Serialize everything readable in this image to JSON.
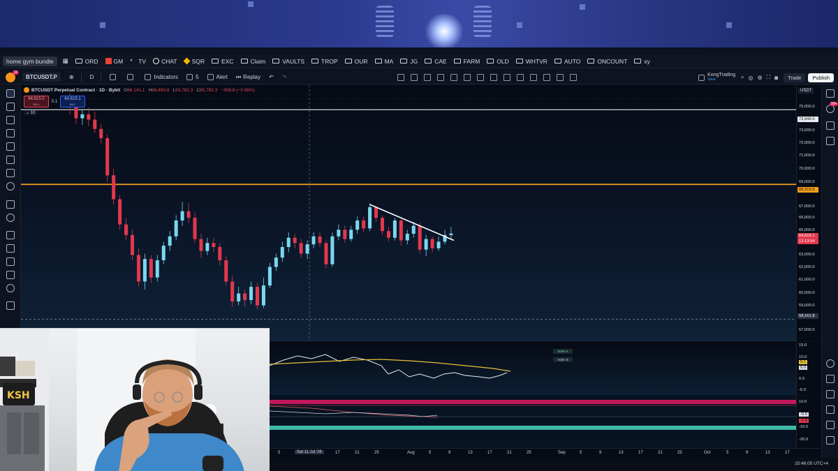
{
  "bookmarks": [
    {
      "label": "ORD",
      "icon": "folder-icon"
    },
    {
      "label": "GM",
      "icon": "gmail-icon"
    },
    {
      "label": "TV",
      "icon": "tradingview-icon"
    },
    {
      "label": "CHAT",
      "icon": "chatgpt-icon"
    },
    {
      "label": "SQR",
      "icon": "binance-icon"
    },
    {
      "label": "EXC",
      "icon": "folder-icon"
    },
    {
      "label": "Claim",
      "icon": "folder-icon"
    },
    {
      "label": "VAULTS",
      "icon": "folder-icon"
    },
    {
      "label": "TROP",
      "icon": "folder-icon"
    },
    {
      "label": "OUR",
      "icon": "folder-icon"
    },
    {
      "label": "MA",
      "icon": "folder-icon"
    },
    {
      "label": "JG",
      "icon": "folder-icon"
    },
    {
      "label": "CAE",
      "icon": "folder-icon"
    },
    {
      "label": "FARM",
      "icon": "folder-icon"
    },
    {
      "label": "OLD",
      "icon": "folder-icon"
    },
    {
      "label": "WHTVR",
      "icon": "folder-icon"
    },
    {
      "label": "AUTO",
      "icon": "folder-icon"
    },
    {
      "label": "ONCOUNT",
      "icon": "folder-icon"
    },
    {
      "label": "xy",
      "icon": "folder-icon"
    }
  ],
  "bookmark_first": "home gym bundle",
  "toolbar": {
    "notif_badge": "11",
    "symbol": "BTCUSDT.P",
    "interval": "D",
    "indicators": "Indicators",
    "layouts_count": "5",
    "alert": "Alert",
    "replay": "Replay",
    "user": "KongTrading",
    "user_sub": "Save",
    "trade": "Trade",
    "publish": "Publish"
  },
  "legend": {
    "title": "BTCUSDT Perpetual Contract · 1D · Bybit",
    "ohlc": [
      {
        "k": "O",
        "v": "66,141.1"
      },
      {
        "k": "H",
        "v": "66,490.8"
      },
      {
        "k": "L",
        "v": "63,782.3"
      },
      {
        "k": "C",
        "v": "65,782.3"
      }
    ],
    "change": "−358.8 (−0.56%)"
  },
  "order": {
    "sell_price": "64,615.0",
    "sell_label": "SELL",
    "qty": "0.1",
    "buy_price": "64,615.1",
    "buy_label": "BUY",
    "collapse": "10"
  },
  "price_scale": {
    "currency": "USDT",
    "labels": [
      "75,000.0",
      "73,000.0",
      "72,000.0",
      "71,000.0",
      "70,000.0",
      "69,000.0",
      "67,000.0",
      "66,000.0",
      "65,000.0",
      "63,000.0",
      "62,000.0",
      "61,000.0",
      "60,000.0",
      "59,000.0",
      "57,000.0"
    ],
    "tag_white": "73,949.0",
    "tag_orange": "68,319.9",
    "tag_last": "64,615.1",
    "tag_timer": "12:13:54",
    "tag_cursor": "58,161.8"
  },
  "pane1_scale": [
    "15.0",
    "10.0",
    "5.1",
    "5.0",
    "0.0",
    "-5.0"
  ],
  "pane2_scale": [
    "10.0",
    "-0.5",
    "-1.8",
    "-10.0",
    "-20.0"
  ],
  "index_labels": [
    "Index A",
    "Index B"
  ],
  "time_axis": [
    "5",
    "Sat 11 Jul '26",
    "17",
    "21",
    "25",
    "Aug",
    "5",
    "9",
    "13",
    "17",
    "21",
    "25",
    "Sep",
    "5",
    "9",
    "13",
    "17",
    "21",
    "25",
    "Oct",
    "5",
    "9",
    "13",
    "17"
  ],
  "clock": "15:46:05 UTC+4",
  "colors": {
    "up": "#7ad7f0",
    "down": "#e2384d",
    "orange_level": "#f59e1b",
    "white_level": "#e8ecf2"
  },
  "chart_data": {
    "type": "candlestick",
    "symbol": "BTCUSDT.P",
    "interval": "1D",
    "ylim": [
      56500,
      75800
    ],
    "levels": [
      73949.0,
      68319.9,
      58161.8
    ],
    "trendline": [
      [
        0,
        66800
      ],
      [
        1,
        64100
      ]
    ],
    "candles": [
      [
        74800,
        74700,
        75200,
        73600
      ],
      [
        74700,
        73300,
        74900,
        72900
      ],
      [
        73300,
        73600,
        74000,
        72800
      ],
      [
        73600,
        73200,
        74100,
        72700
      ],
      [
        73200,
        72500,
        73800,
        72200
      ],
      [
        72500,
        71800,
        72900,
        71400
      ],
      [
        71800,
        69000,
        72100,
        68500
      ],
      [
        69000,
        67200,
        69500,
        66800
      ],
      [
        67200,
        65300,
        67500,
        64900
      ],
      [
        65300,
        64500,
        65800,
        64100
      ],
      [
        64500,
        63000,
        64900,
        62600
      ],
      [
        63000,
        61000,
        63500,
        60600
      ],
      [
        61000,
        62700,
        63100,
        60400
      ],
      [
        62700,
        61300,
        63000,
        60900
      ],
      [
        61300,
        62600,
        63000,
        61000
      ],
      [
        62600,
        63700,
        64000,
        62300
      ],
      [
        63700,
        64400,
        64800,
        63300
      ],
      [
        64400,
        65600,
        66000,
        64100
      ],
      [
        65600,
        66300,
        67000,
        65200
      ],
      [
        66300,
        65800,
        66900,
        65400
      ],
      [
        65800,
        64200,
        66200,
        63900
      ],
      [
        64200,
        63300,
        64600,
        62800
      ],
      [
        63300,
        63900,
        64300,
        63000
      ],
      [
        63900,
        63600,
        64300,
        63200
      ],
      [
        63600,
        62600,
        63900,
        62200
      ],
      [
        62600,
        61000,
        62900,
        60700
      ],
      [
        61000,
        59500,
        61400,
        59100
      ],
      [
        59500,
        60100,
        60600,
        59200
      ],
      [
        60100,
        59600,
        60400,
        59100
      ],
      [
        59600,
        60600,
        61000,
        59300
      ],
      [
        60600,
        59200,
        60900,
        58900
      ],
      [
        59200,
        60700,
        61300,
        59000
      ],
      [
        60700,
        62100,
        62400,
        60500
      ],
      [
        62100,
        62800,
        63100,
        61800
      ],
      [
        62800,
        63600,
        64000,
        62500
      ],
      [
        63600,
        64300,
        64700,
        63200
      ],
      [
        64300,
        63900,
        64600,
        63500
      ],
      [
        63900,
        63100,
        64200,
        62800
      ],
      [
        63100,
        63800,
        64100,
        62700
      ],
      [
        63800,
        64400,
        64700,
        63500
      ],
      [
        64400,
        63900,
        64700,
        63600
      ],
      [
        63900,
        62300,
        64100,
        62000
      ],
      [
        62300,
        64400,
        64700,
        62100
      ],
      [
        64400,
        64900,
        65300,
        64100
      ],
      [
        64900,
        64200,
        65200,
        63900
      ],
      [
        64200,
        64900,
        65200,
        64000
      ],
      [
        64900,
        65600,
        65900,
        64600
      ],
      [
        65600,
        65000,
        65900,
        64700
      ],
      [
        65000,
        66600,
        66900,
        64800
      ],
      [
        66600,
        65800,
        66700,
        65500
      ],
      [
        65800,
        64800,
        66000,
        64500
      ],
      [
        64800,
        64300,
        65100,
        64000
      ],
      [
        64300,
        65600,
        65800,
        64100
      ],
      [
        65600,
        64100,
        65700,
        63700
      ],
      [
        64100,
        64600,
        64900,
        63800
      ],
      [
        64600,
        65200,
        65500,
        64300
      ],
      [
        65200,
        63400,
        65400,
        63100
      ],
      [
        63400,
        64200,
        64500,
        62900
      ],
      [
        64200,
        63500,
        64400,
        63200
      ],
      [
        63500,
        64000,
        64400,
        63300
      ],
      [
        64000,
        64500,
        64900,
        63800
      ],
      [
        64500,
        64615,
        65100,
        64200
      ]
    ]
  }
}
